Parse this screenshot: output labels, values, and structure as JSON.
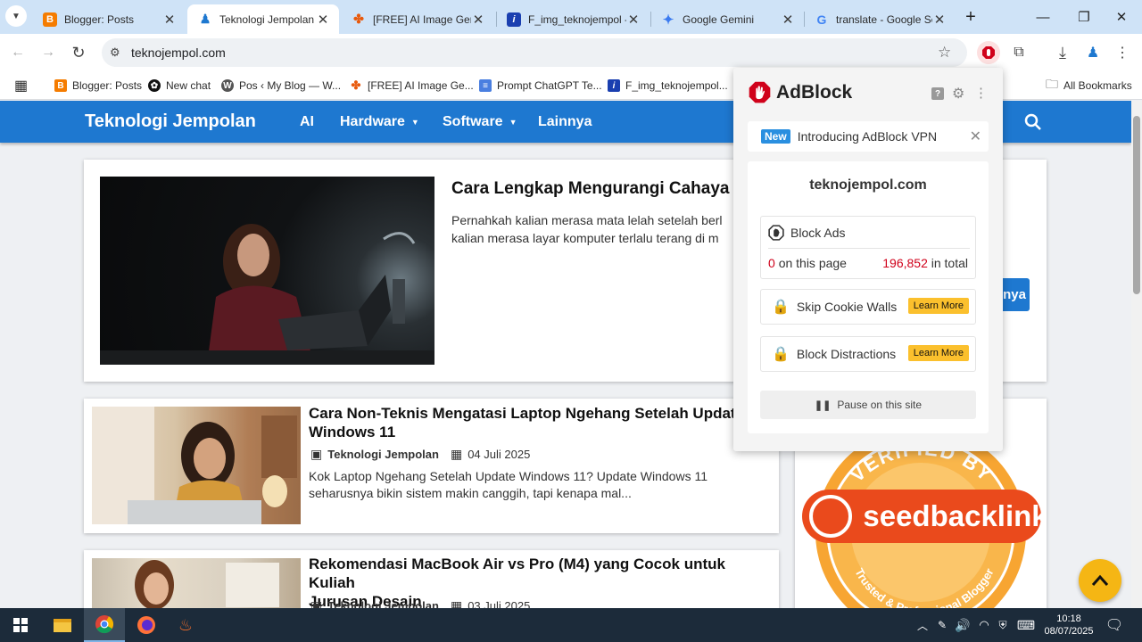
{
  "browser": {
    "tabs": [
      {
        "title": "Blogger: Posts",
        "active": false
      },
      {
        "title": "Teknologi Jempolan",
        "active": true
      },
      {
        "title": "[FREE] AI Image Gene",
        "active": false
      },
      {
        "title": "F_img_teknojempol -",
        "active": false
      },
      {
        "title": "Google Gemini",
        "active": false
      },
      {
        "title": "translate - Google Se",
        "active": false
      }
    ],
    "url": "teknojempol.com",
    "bookmarks": [
      "Blogger: Posts",
      "New chat",
      "Pos ‹ My Blog — W...",
      "[FREE] AI Image Ge...",
      "Prompt ChatGPT Te...",
      "F_img_teknojempol..."
    ],
    "all_bookmarks": "All Bookmarks"
  },
  "site": {
    "brand": "Teknologi Jempolan",
    "nav": [
      "AI",
      "Hardware",
      "Software",
      "Lainnya"
    ],
    "featured": {
      "title": "Cara Lengkap Mengurangi Cahaya",
      "excerpt_line1": "Pernahkah kalian merasa mata lelah setelah berl",
      "excerpt_line2": "kalian merasa layar komputer terlalu terang di m",
      "button_partial": "nya"
    },
    "posts": [
      {
        "title_line1": "Cara Non-Teknis Mengatasi Laptop Ngehang Setelah Update",
        "title_line2": "Windows 11",
        "author": "Teknologi Jempolan",
        "date": "04 Juli 2025",
        "excerpt_line1": "Kok Laptop Ngehang Setelah Update Windows 11? Update Windows 11",
        "excerpt_line2": "seharusnya bikin sistem makin canggih, tapi kenapa mal..."
      },
      {
        "title_line1": "Rekomendasi MacBook Air vs Pro (M4) yang Cocok untuk Kuliah",
        "title_line2": "Jurusan Desain",
        "author": "Teknologi Jempolan",
        "date": "03 Juli 2025"
      }
    ],
    "badge": {
      "top_text": "VERIFIED BY",
      "brand": "seedbacklink",
      "bottom_text": "Trusted & Professional Blogger"
    }
  },
  "adblock": {
    "brand": "AdBlock",
    "new_badge": "New",
    "promo": "Introducing AdBlock VPN",
    "domain": "teknojempol.com",
    "block_ads": "Block Ads",
    "page_count": "0",
    "page_label": "on this page",
    "total_count": "196,852",
    "total_label": "in total",
    "skip_cookie": "Skip Cookie Walls",
    "block_distractions": "Block Distractions",
    "learn_more": "Learn More",
    "pause": "Pause on this site"
  },
  "taskbar": {
    "time": "10:18",
    "date": "08/07/2025"
  }
}
